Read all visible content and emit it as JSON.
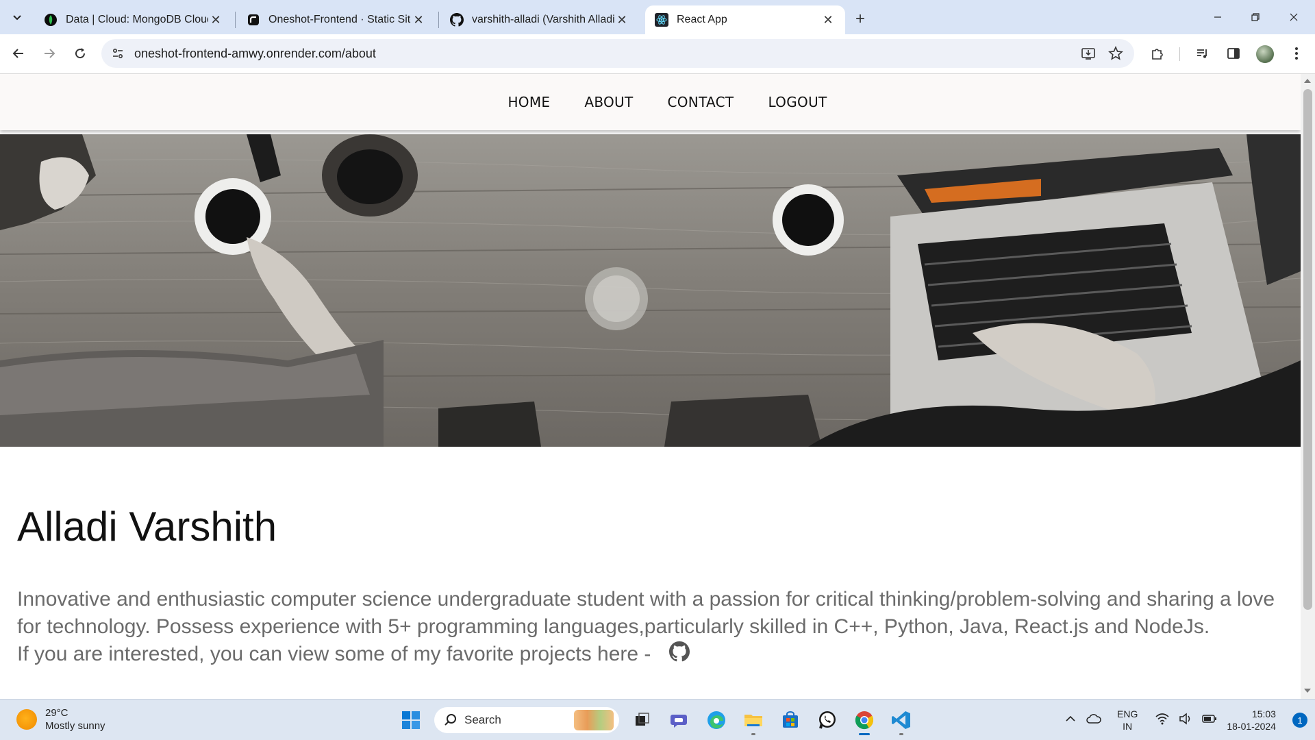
{
  "browser": {
    "tabs": [
      {
        "title": "Data | Cloud: MongoDB Cloud",
        "icon": "mongodb-leaf-icon"
      },
      {
        "title": "Oneshot-Frontend · Static Site",
        "icon": "render-logo-icon"
      },
      {
        "title": "varshith-alladi (Varshith Alladi)",
        "icon": "github-icon"
      },
      {
        "title": "React App",
        "icon": "react-icon"
      }
    ],
    "active_tab_index": 3,
    "url": "oneshot-frontend-amwy.onrender.com/about"
  },
  "page": {
    "nav": {
      "home": "HOME",
      "about": "ABOUT",
      "contact": "CONTACT",
      "logout": "LOGOUT"
    },
    "name": "Alladi Varshith",
    "bio_line1": "Innovative and enthusiastic computer science undergraduate student with a passion for critical thinking/problem-solving and sharing a love for technology. Possess experience with 5+ programming languages,particularly skilled in C++, Python, Java, React.js and NodeJs.",
    "bio_line2": "If you are interested, you can view some of my favorite projects here -"
  },
  "taskbar": {
    "weather_temp": "29°C",
    "weather_desc": "Mostly sunny",
    "search_placeholder": "Search",
    "lang_top": "ENG",
    "lang_bottom": "IN",
    "time": "15:03",
    "date": "18-01-2024",
    "notification_count": "1"
  }
}
